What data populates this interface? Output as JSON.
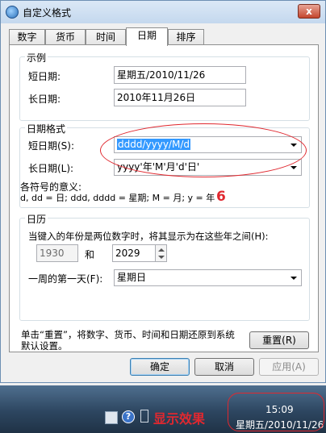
{
  "window": {
    "title": "自定义格式",
    "close_label": "x"
  },
  "tabs": [
    {
      "label": "数字"
    },
    {
      "label": "货币"
    },
    {
      "label": "时间"
    },
    {
      "label": "日期"
    },
    {
      "label": "排序"
    }
  ],
  "examples": {
    "title": "示例",
    "short_label": "短日期:",
    "short_value": "星期五/2010/11/26",
    "long_label": "长日期:",
    "long_value": "2010年11月26日"
  },
  "date_formats": {
    "title": "日期格式",
    "short_label": "短日期(S):",
    "short_value": "dddd/yyyy/M/d",
    "long_label": "长日期(L):",
    "long_value": "yyyy'年'M'月'd'日'",
    "symbols_title": "各符号的意义:",
    "symbols_text": "d, dd = 日;  ddd, dddd = 星期;  M = 月;  y = 年"
  },
  "calendar": {
    "title": "日历",
    "two_digit_text": "当键入的年份是两位数字时，将其显示为在这些年之间(H):",
    "year_from": "1930",
    "and_label": "和",
    "year_to": "2029",
    "first_day_label": "一周的第一天(F):",
    "first_day_value": "星期日"
  },
  "reset": {
    "hint": "单击“重置”，将数字、货币、时间和日期还原到系统默认设置。",
    "button": "重置(R)"
  },
  "buttons": {
    "ok": "确定",
    "cancel": "取消",
    "apply": "应用(A)"
  },
  "annotations": {
    "number": "6",
    "caption": "显示效果"
  },
  "taskbar": {
    "time": "15:09",
    "date": "星期五/2010/11/26"
  },
  "colors": {
    "annotation": "#e0282f",
    "selection": "#3399ff",
    "taskbar": "#2d4660"
  }
}
